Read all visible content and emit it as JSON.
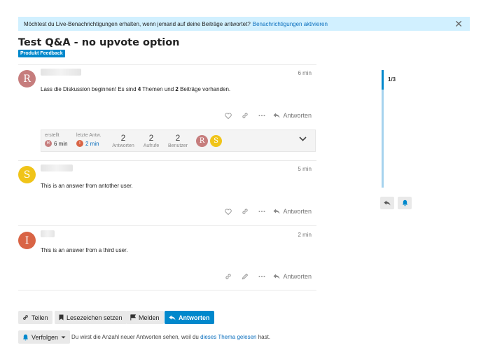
{
  "notice": {
    "text": "Möchtest du Live-Benachrichtigungen erhalten, wenn jemand auf deine Beiträge antwortet?",
    "link": "Benachrichtigungen aktivieren",
    "close": "✕"
  },
  "topic": {
    "title": "Test Q&A - no upvote option",
    "category": "Produkt Feedback"
  },
  "posts": [
    {
      "avatar_letter": "R",
      "avatar_color": "#c67d7d",
      "time": "6 min",
      "text_a": "Lass die Diskussion beginnen! Es sind ",
      "text_b": "4",
      "text_c": " Themen und ",
      "text_d": "2",
      "text_e": " Beiträge vorhanden.",
      "reply": "Antworten"
    },
    {
      "avatar_letter": "S",
      "avatar_color": "#f0c419",
      "time": "5 min",
      "text": "This is an answer from antother user.",
      "reply": "Antworten"
    },
    {
      "avatar_letter": "I",
      "avatar_color": "#d96445",
      "time": "2 min",
      "text": "This is an answer from a third user.",
      "reply": "Antworten"
    }
  ],
  "summary": {
    "created_label": "erstellt",
    "created_letter": "R",
    "created_time": "6 min",
    "last_label": "letzte Antw.",
    "last_letter": "I",
    "last_time": "2 min",
    "replies": "2",
    "replies_label": "Antworten",
    "views": "2",
    "views_label": "Aufrufe",
    "users": "2",
    "users_label": "Benutzer",
    "user_avatars": [
      "R",
      "S"
    ]
  },
  "timeline": {
    "label": "1/3"
  },
  "footer": {
    "share": "Teilen",
    "bookmark": "Lesezeichen setzen",
    "flag": "Melden",
    "reply": "Antworten",
    "follow": "Verfolgen",
    "follow_text_a": "Du wirst die Anzahl neuer Antworten sehen, weil du",
    "follow_link": "dieses Thema gelesen",
    "follow_text_b": "hast."
  },
  "colors": {
    "accent": "#0088cc",
    "notice_bg": "#d1f0ff"
  }
}
